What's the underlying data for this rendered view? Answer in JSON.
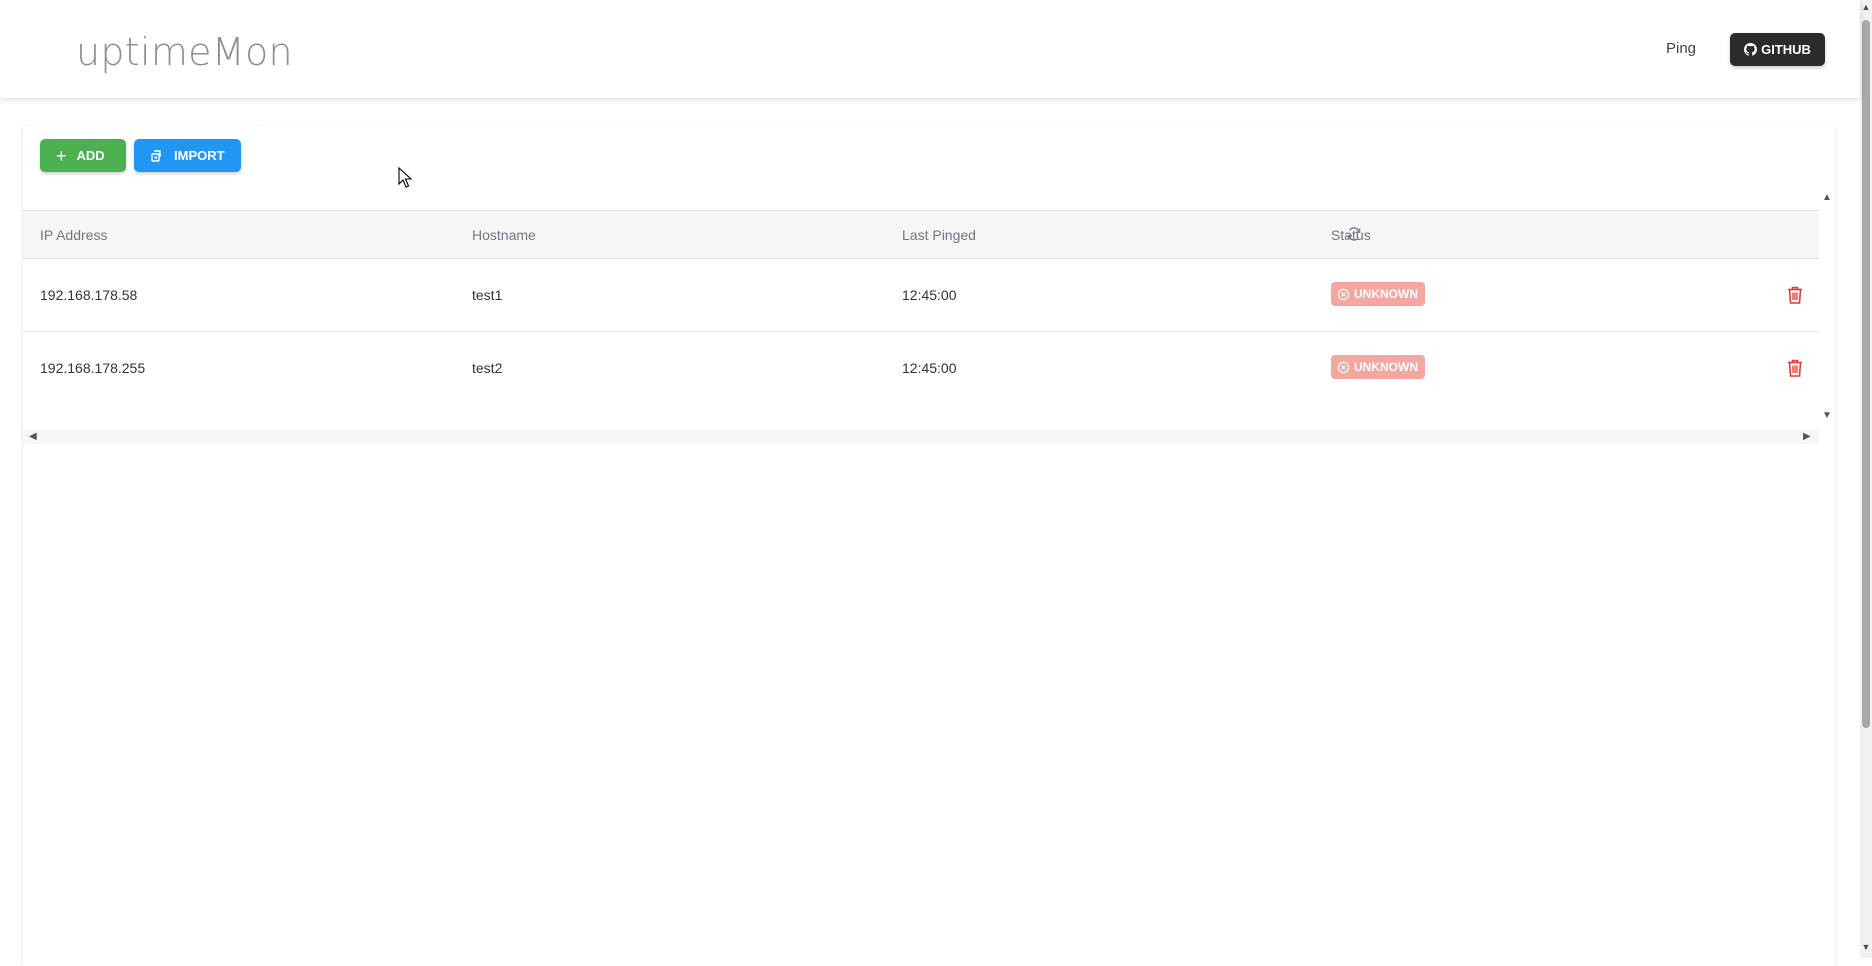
{
  "header": {
    "brand": "uptimeMon",
    "nav_ping": "Ping",
    "github_label": "GITHUB"
  },
  "toolbar": {
    "add_label": "ADD",
    "import_label": "IMPORT"
  },
  "table": {
    "columns": [
      "IP Address",
      "Hostname",
      "Last Pinged",
      "Status"
    ],
    "rows": [
      {
        "ip": "192.168.178.58",
        "hostname": "test1",
        "last_pinged": "12:45:00",
        "status": "UNKNOWN"
      },
      {
        "ip": "192.168.178.255",
        "hostname": "test2",
        "last_pinged": "12:45:00",
        "status": "UNKNOWN"
      }
    ]
  },
  "colors": {
    "add": "#4caf50",
    "import": "#2196f3",
    "github": "#2b2b2b",
    "status_unknown": "#f4a7a1",
    "delete": "#e53935"
  },
  "icons": {
    "add": "plus-icon",
    "import": "import-icon",
    "github": "github-icon",
    "refresh": "refresh-icon",
    "status": "close-circle-icon",
    "delete": "trash-icon"
  }
}
